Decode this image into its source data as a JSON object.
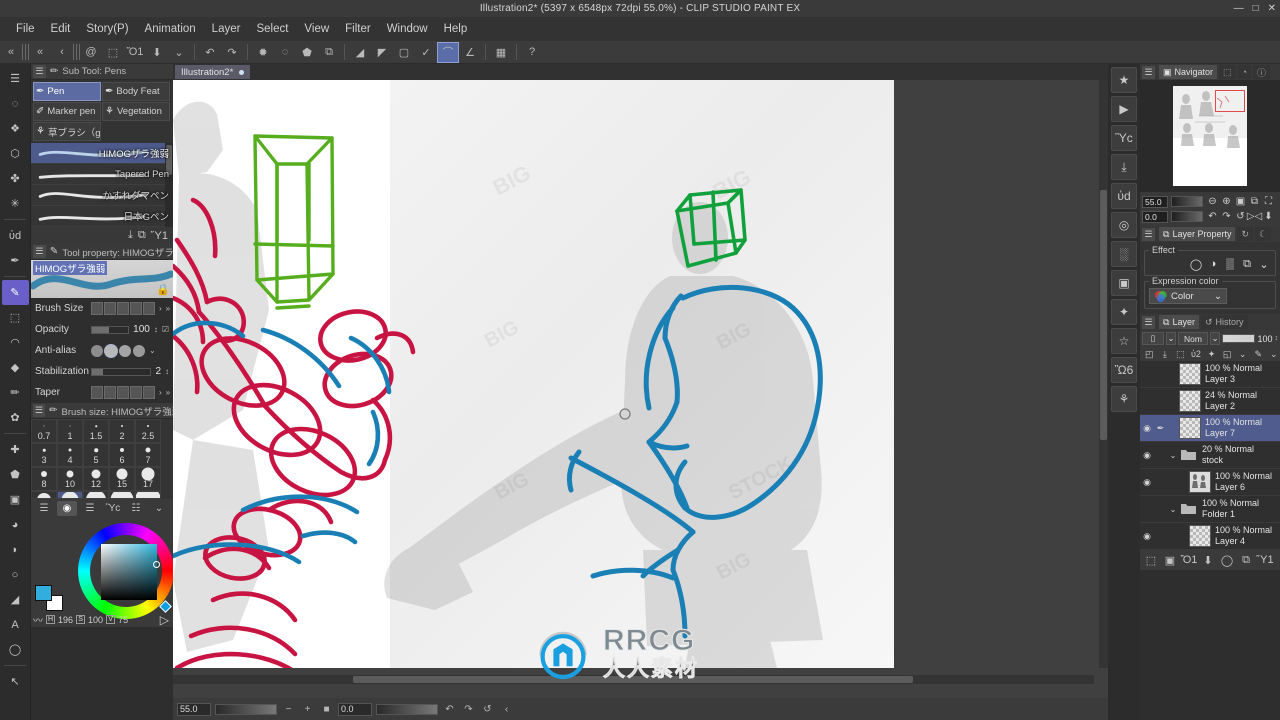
{
  "window": {
    "title": "Illustration2* (5397 x 6548px 72dpi 55.0%)  - CLIP STUDIO PAINT EX",
    "minimize": "—",
    "maximize": "□",
    "close": "✕"
  },
  "menubar": {
    "items": [
      {
        "label": "File"
      },
      {
        "label": "Edit"
      },
      {
        "label": "Story(P)"
      },
      {
        "label": "Animation"
      },
      {
        "label": "Layer"
      },
      {
        "label": "Select"
      },
      {
        "label": "View"
      },
      {
        "label": "Filter"
      },
      {
        "label": "Window"
      },
      {
        "label": "Help"
      }
    ]
  },
  "commandbar": {
    "icons": [
      {
        "name": "collapse-left-double",
        "glyph": "«"
      },
      {
        "name": "grip-handle",
        "glyph": ""
      },
      {
        "name": "nav-back-double",
        "glyph": "«"
      },
      {
        "name": "nav-back",
        "glyph": "‹"
      },
      {
        "name": "grip-handle-2",
        "glyph": ""
      },
      {
        "name": "clip-studio-logo",
        "glyph": "@"
      },
      {
        "name": "new-document",
        "glyph": "⬚"
      },
      {
        "name": "open-file",
        "glyph": "Ὄ1"
      },
      {
        "name": "save-file",
        "glyph": "⬇"
      },
      {
        "name": "save-dropdown",
        "glyph": "⌄"
      },
      {
        "name": "undo",
        "glyph": "↶"
      },
      {
        "name": "redo",
        "glyph": "↷"
      },
      {
        "name": "selection-marching-ants",
        "glyph": "✹"
      },
      {
        "name": "deselect",
        "glyph": "◌"
      },
      {
        "name": "fill-selection",
        "glyph": "⬟"
      },
      {
        "name": "transform",
        "glyph": "⧉"
      },
      {
        "name": "ruler-snap-off",
        "glyph": "◢"
      },
      {
        "name": "ruler-snap-grad",
        "glyph": "◤"
      },
      {
        "name": "ruler-snap-square",
        "glyph": "▢"
      },
      {
        "name": "snap-special-ruler",
        "glyph": "✓"
      },
      {
        "name": "snap-curve-ruler",
        "glyph": "⌒"
      },
      {
        "name": "snap-perspective-ruler",
        "glyph": "∠"
      },
      {
        "name": "quick-access",
        "glyph": "▦"
      },
      {
        "name": "help-question",
        "glyph": "?"
      }
    ]
  },
  "toolbar": {
    "tools": [
      {
        "name": "menu-hamburger",
        "glyph": "☰"
      },
      {
        "name": "lasso-select-tool",
        "glyph": "◌"
      },
      {
        "name": "auto-select-tool",
        "glyph": "❖"
      },
      {
        "name": "object-operation-tool",
        "glyph": "⬡"
      },
      {
        "name": "move-tool",
        "glyph": "✤"
      },
      {
        "name": "magic-wand-tool",
        "glyph": "✳"
      },
      {
        "name": "zoom-tool",
        "glyph": "ὐd"
      },
      {
        "name": "eyedropper-tool",
        "glyph": "✒"
      },
      {
        "name": "pen-tool",
        "glyph": "✎",
        "selected": true
      },
      {
        "name": "marquee-select-tool",
        "glyph": "⬚"
      },
      {
        "name": "airbrush-tool",
        "glyph": "◠"
      },
      {
        "name": "eraser-tool",
        "glyph": "◆"
      },
      {
        "name": "pencil-tool",
        "glyph": "✏"
      },
      {
        "name": "decoration-tool",
        "glyph": "✿"
      },
      {
        "name": "blend-tool",
        "glyph": "✚"
      },
      {
        "name": "gradient-tool",
        "glyph": "⬟"
      },
      {
        "name": "fill-tool",
        "glyph": "▣"
      },
      {
        "name": "blur-tool",
        "glyph": "◕"
      },
      {
        "name": "figure-curve-tool",
        "glyph": "◗"
      },
      {
        "name": "ellipse-tool",
        "glyph": "○"
      },
      {
        "name": "ruler-tool",
        "glyph": "◢"
      },
      {
        "name": "text-tool",
        "glyph": "A"
      },
      {
        "name": "balloon-tool",
        "glyph": "◯"
      },
      {
        "name": "correct-line-tool",
        "glyph": "↖"
      }
    ]
  },
  "subtool_panel": {
    "title": "Sub Tool: Pens",
    "cells": [
      {
        "label": "Pen",
        "icon": "pen-nib-icon",
        "glyph": "✒",
        "selected": true
      },
      {
        "label": "Body Feat",
        "icon": "pen-nib-icon",
        "glyph": "✒",
        "selected": false
      },
      {
        "label": "Marker pen",
        "icon": "marker-icon",
        "glyph": "✐",
        "selected": false
      },
      {
        "label": "Vegetation",
        "icon": "grass-icon",
        "glyph": "⚘",
        "selected": false
      },
      {
        "label": "草ブラシ（g",
        "icon": "grass-icon",
        "glyph": "⚘",
        "selected": false
      }
    ],
    "brushes": [
      {
        "label": "日本Gペン",
        "selected": false
      },
      {
        "label": "かすれダマペン",
        "selected": false
      },
      {
        "label": "Tapered Pen",
        "selected": false
      },
      {
        "label": "HIMOGザラ強弱",
        "selected": true
      }
    ],
    "buttons": [
      {
        "name": "import-subtool-button",
        "glyph": "⤓"
      },
      {
        "name": "duplicate-subtool-button",
        "glyph": "⧉"
      },
      {
        "name": "delete-subtool-button",
        "glyph": "Ὕ1"
      }
    ]
  },
  "tool_property": {
    "title": "Tool property: HIMOGザラ",
    "preview_label": "HIMOGザラ強弱",
    "rows": [
      {
        "label": "Brush Size",
        "value": "",
        "name": "brush-size-row"
      },
      {
        "label": "Opacity",
        "value": "100",
        "name": "opacity-row"
      },
      {
        "label": "Anti-alias",
        "value": "",
        "name": "anti-alias-row"
      },
      {
        "label": "Stabilization",
        "value": "2",
        "name": "stabilization-row"
      },
      {
        "label": "Taper",
        "value": "",
        "name": "taper-row"
      }
    ]
  },
  "brush_size_panel": {
    "title": "Brush size: HIMOGザラ強弱",
    "sizes": [
      {
        "label": "0.7",
        "dot": 1
      },
      {
        "label": "1",
        "dot": 1
      },
      {
        "label": "1.5",
        "dot": 1.5
      },
      {
        "label": "2",
        "dot": 2
      },
      {
        "label": "2.5",
        "dot": 2
      },
      {
        "label": "3",
        "dot": 2.5
      },
      {
        "label": "4",
        "dot": 3
      },
      {
        "label": "5",
        "dot": 3.5
      },
      {
        "label": "6",
        "dot": 4
      },
      {
        "label": "7",
        "dot": 5
      },
      {
        "label": "8",
        "dot": 6
      },
      {
        "label": "10",
        "dot": 7
      },
      {
        "label": "12",
        "dot": 9
      },
      {
        "label": "15",
        "dot": 11
      },
      {
        "label": "17",
        "dot": 13
      }
    ],
    "footer_icons": [
      {
        "name": "brush-size-palette-tab",
        "glyph": "◉",
        "active": true
      },
      {
        "name": "color-set-tab",
        "glyph": "☰",
        "active": false
      },
      {
        "name": "material-tab",
        "glyph": "Ὓc",
        "active": false
      },
      {
        "name": "sub-view-tab",
        "glyph": "☷",
        "active": false
      },
      {
        "name": "more-tabs",
        "glyph": "⌄",
        "active": false
      }
    ]
  },
  "color_wheel": {
    "name": "color-wheel-panel",
    "hsv": [
      {
        "tag": "H",
        "value": "196"
      },
      {
        "tag": "S",
        "value": "100"
      },
      {
        "tag": "V",
        "value": "75"
      }
    ],
    "foreground": "#31aedd",
    "background": "#ffffff",
    "play_icon": "▷"
  },
  "document": {
    "tab_label": "Illustration2*",
    "tab_close": "●"
  },
  "statusbar": {
    "zoom": "55.0",
    "rotation": "0.0",
    "zoom_out": "−",
    "zoom_in": "+",
    "fit": "■",
    "rotate_left": "↶",
    "rotate_right": "↷",
    "reset_rotation": "↺",
    "flip": "‹"
  },
  "watermark": {
    "brand": "RRCG",
    "subtitle": "人人素材"
  },
  "right_rail": {
    "buttons": [
      {
        "name": "material-favorite-icon",
        "glyph": "★"
      },
      {
        "name": "material-video-icon",
        "glyph": "▶"
      },
      {
        "name": "material-image-icon",
        "glyph": "Ὓc"
      },
      {
        "name": "material-download-icon",
        "glyph": "⤓"
      },
      {
        "name": "material-search-icon",
        "glyph": "ὐd"
      },
      {
        "name": "material-camera-icon",
        "glyph": "◎"
      },
      {
        "name": "material-pattern-icon",
        "glyph": "░"
      },
      {
        "name": "material-frame-icon",
        "glyph": "▣"
      },
      {
        "name": "material-3d-icon",
        "glyph": "✦"
      },
      {
        "name": "material-star-icon",
        "glyph": "☆"
      },
      {
        "name": "material-pose-icon",
        "glyph": "Ὣ6"
      },
      {
        "name": "material-figure-icon",
        "glyph": "⚘"
      }
    ]
  },
  "navigator": {
    "tabs": [
      {
        "label": "Navigator",
        "icon": "navigator-icon",
        "glyph": "▣",
        "active": true
      },
      {
        "label": "",
        "icon": "sub-view-icon",
        "glyph": "⬚",
        "active": false
      },
      {
        "label": "",
        "icon": "item-bank-icon",
        "glyph": "◔",
        "active": false
      },
      {
        "label": "",
        "icon": "info-icon",
        "glyph": "ⓘ",
        "active": false
      }
    ],
    "zoom_value": "55.0",
    "rotation_value": "0.0",
    "controls_row1": [
      {
        "name": "zoom-out-button",
        "glyph": "⊖"
      },
      {
        "name": "zoom-in-button",
        "glyph": "⊕"
      },
      {
        "name": "fit-to-screen-button",
        "glyph": "▣"
      },
      {
        "name": "fit-window-button",
        "glyph": "⧉"
      },
      {
        "name": "full-screen-button",
        "glyph": "⛶"
      }
    ],
    "controls_row2": [
      {
        "name": "rotate-left-button",
        "glyph": "↶"
      },
      {
        "name": "rotate-right-button",
        "glyph": "↷"
      },
      {
        "name": "reset-rotation-button",
        "glyph": "↺"
      },
      {
        "name": "flip-horizontal-button",
        "glyph": "▷◁"
      },
      {
        "name": "flip-vertical-button",
        "glyph": "⬇"
      }
    ]
  },
  "layer_property": {
    "tabs": [
      {
        "label": "Layer Property",
        "icon": "layer-property-icon",
        "glyph": "⧉",
        "active": true
      },
      {
        "label": "",
        "icon": "animation-icon",
        "glyph": "↻",
        "active": false
      },
      {
        "label": "",
        "icon": "moon-icon",
        "glyph": "☾",
        "active": false
      }
    ],
    "effect_caption": "Effect",
    "effect_icons": [
      {
        "name": "effect-none-icon",
        "glyph": "◯"
      },
      {
        "name": "effect-border-icon",
        "glyph": "◑"
      },
      {
        "name": "effect-tone-icon",
        "glyph": "▒"
      },
      {
        "name": "effect-layer-color-icon",
        "glyph": "⧉"
      },
      {
        "name": "effect-dropdown-icon",
        "glyph": "⌄"
      }
    ],
    "expression_caption": "Expression color",
    "expression_value": "Color",
    "expression_dropdown": "⌄"
  },
  "layer_panel": {
    "tabs": [
      {
        "label": "Layer",
        "icon": "layers-stack-icon",
        "glyph": "⧉",
        "active": true
      },
      {
        "label": "History",
        "icon": "history-icon",
        "glyph": "↺",
        "active": false
      }
    ],
    "blend_mode": "Normal",
    "blend_mode_short": "Nom",
    "opacity": "100",
    "option_icons": [
      {
        "name": "clip-to-layer-below-icon",
        "glyph": "◰"
      },
      {
        "name": "layer-mask-icon",
        "glyph": "⤓"
      },
      {
        "name": "lock-transparent-pixels-icon",
        "glyph": "⬚"
      },
      {
        "name": "lock-layer-icon",
        "glyph": "ὑ2"
      },
      {
        "name": "ruler-range-icon",
        "glyph": "✦"
      },
      {
        "name": "draft-layer-icon",
        "glyph": "◱"
      },
      {
        "name": "draft-dropdown-icon",
        "glyph": "⌄"
      },
      {
        "name": "reference-layer-icon",
        "glyph": "✎"
      },
      {
        "name": "reference-dropdown-icon",
        "glyph": "⌄"
      }
    ],
    "layers": [
      {
        "opacity": "100 % Normal",
        "name": "Layer 3",
        "type": "raster",
        "visible": false,
        "selected": false,
        "indent": 0
      },
      {
        "opacity": "24 % Normal",
        "name": "Layer 2",
        "type": "raster",
        "visible": false,
        "selected": false,
        "indent": 0
      },
      {
        "opacity": "100 % Normal",
        "name": "Layer 7",
        "type": "raster",
        "visible": true,
        "selected": true,
        "indent": 0
      },
      {
        "opacity": "20 % Normal",
        "name": "stock",
        "type": "folder",
        "visible": true,
        "selected": false,
        "indent": 0
      },
      {
        "opacity": "100 % Normal",
        "name": "Layer 6",
        "type": "image",
        "visible": true,
        "selected": false,
        "indent": 1
      },
      {
        "opacity": "100 % Normal",
        "name": "Folder 1",
        "type": "folder",
        "visible": false,
        "selected": false,
        "indent": 0
      },
      {
        "opacity": "100 % Normal",
        "name": "Layer 4",
        "type": "raster",
        "visible": true,
        "selected": false,
        "indent": 1
      }
    ],
    "footer_icons": [
      {
        "name": "new-raster-layer-button",
        "glyph": "⬚"
      },
      {
        "name": "new-tone-layer-button",
        "glyph": "▣"
      },
      {
        "name": "new-layer-folder-button",
        "glyph": "Ὄ1"
      },
      {
        "name": "transfer-down-button",
        "glyph": "⬇"
      },
      {
        "name": "create-mask-button",
        "glyph": "◯"
      },
      {
        "name": "duplicate-layer-button",
        "glyph": "⧉"
      },
      {
        "name": "delete-layer-button",
        "glyph": "Ὕ1"
      }
    ]
  },
  "colors": {
    "accent_blue": "#5a6da8",
    "selection_blue": "#4f5c8d",
    "panel_bg": "#2e2e2e",
    "chrome_bg": "#3a3a3a",
    "canvas_bg": "#404040",
    "draw_red": "#c81442",
    "draw_green": "#56ad1e",
    "draw_green_dark": "#11a13c",
    "draw_blue": "#1a7fb5"
  }
}
